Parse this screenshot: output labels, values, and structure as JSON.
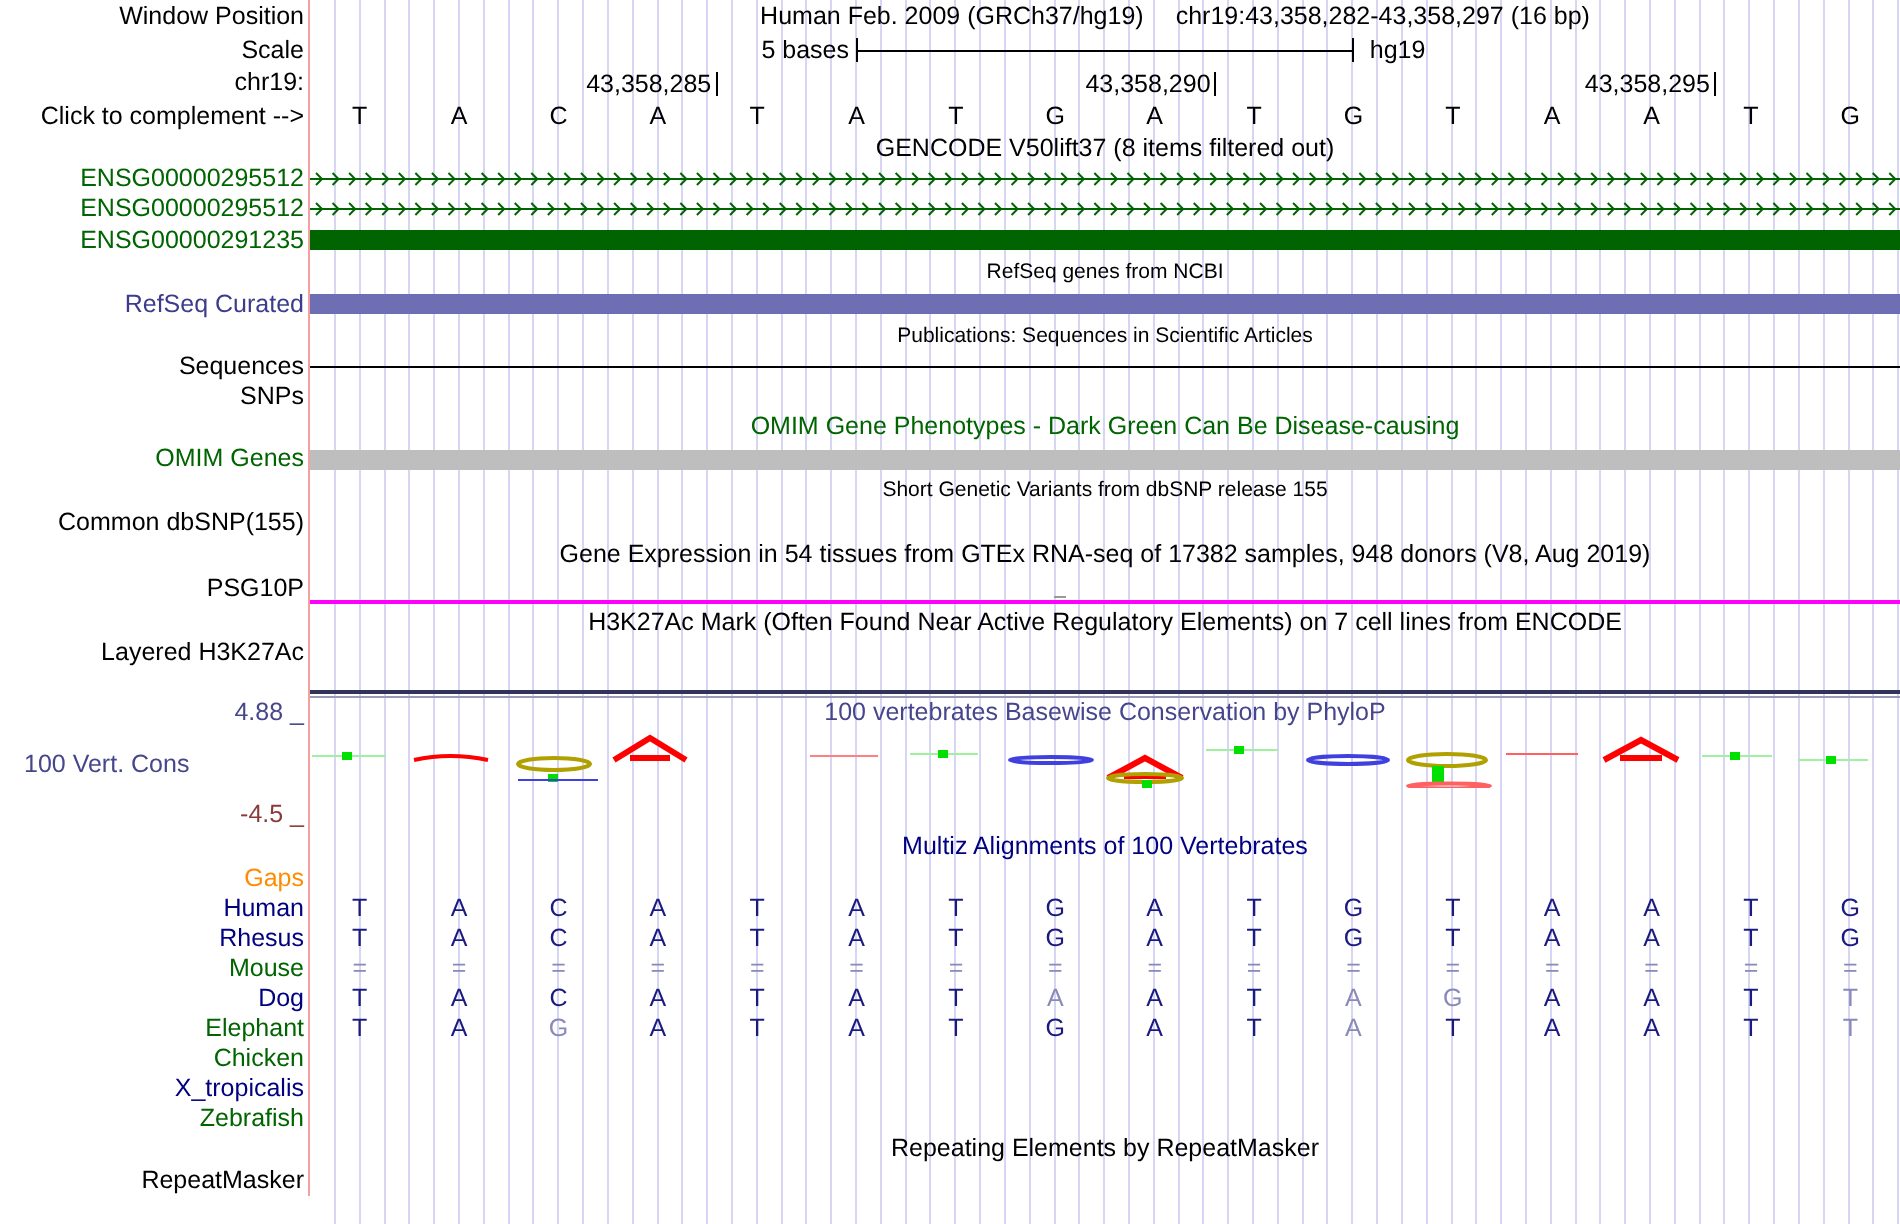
{
  "header": {
    "position_label": "Window Position",
    "assembly_title": "Human Feb. 2009 (GRCh37/hg19)",
    "position": "chr19:43,358,282-43,358,297 (16 bp)",
    "scale_label": "Scale",
    "scale_text": "5 bases",
    "scale_db": "hg19",
    "chrom_label": "chr19:",
    "ticks": [
      "43,358,285",
      "43,358,290",
      "43,358,295"
    ],
    "complement_label": "Click to complement -->",
    "bases": [
      "T",
      "A",
      "C",
      "A",
      "T",
      "A",
      "T",
      "G",
      "A",
      "T",
      "G",
      "T",
      "A",
      "A",
      "T",
      "G"
    ]
  },
  "tracks": [
    {
      "kind": "title",
      "text": "GENCODE V50lift37 (8 items filtered out)",
      "color": "#000000"
    },
    {
      "kind": "arrows",
      "label": "ENSG00000295512",
      "color": "#006400",
      "feature": {
        "color": "#006400"
      }
    },
    {
      "kind": "arrows",
      "label": "ENSG00000295512",
      "color": "#006400",
      "feature": {
        "color": "#006400"
      }
    },
    {
      "kind": "bar",
      "label": "ENSG00000291235",
      "color": "#006400",
      "feature": {
        "color": "#006400"
      }
    },
    {
      "kind": "subtitle",
      "text": "RefSeq genes from NCBI",
      "color": "#000000"
    },
    {
      "kind": "bar",
      "label": "RefSeq Curated",
      "color": "#3c3c8c",
      "feature": {
        "color": "#6e6eb4"
      }
    },
    {
      "kind": "subtitle",
      "text": "Publications: Sequences in Scientific Articles",
      "color": "#000000"
    },
    {
      "kind": "line",
      "label": "Sequences",
      "color": "#000000",
      "feature": {
        "color": "#000000"
      }
    },
    {
      "kind": "empty",
      "label": "SNPs",
      "color": "#000000"
    },
    {
      "kind": "title",
      "text": "OMIM Gene Phenotypes - Dark Green Can Be Disease-causing",
      "color": "#006400"
    },
    {
      "kind": "bar",
      "label": "OMIM Genes",
      "color": "#006400",
      "feature": {
        "color": "#bebebe"
      }
    },
    {
      "kind": "subtitle",
      "text": "Short Genetic Variants from dbSNP release 155",
      "color": "#000000"
    },
    {
      "kind": "empty",
      "label": "Common dbSNP(155)",
      "color": "#000000"
    },
    {
      "kind": "title",
      "text": "Gene Expression in 54 tissues from GTEx RNA-seq of 17382 samples, 948 donors (V8, Aug 2019)",
      "color": "#000000"
    },
    {
      "kind": "baseline",
      "label": "PSG10P",
      "color": "#000000",
      "feature": {
        "color": "#ff00ff"
      }
    },
    {
      "kind": "title",
      "text": "H3K27Ac Mark (Often Found Near Active Regulatory Elements) on 7 cell lines from ENCODE",
      "color": "#000000"
    },
    {
      "kind": "layered",
      "label": "Layered H3K27Ac",
      "color": "#000000",
      "feature": {
        "color": "#33335a"
      }
    },
    {
      "kind": "conservation",
      "label": "100 Vert. Cons",
      "color": "#46468c",
      "max": "4.88 _",
      "min": "-4.5 _",
      "text": "100 vertebrates Basewise Conservation by PhyloP"
    },
    {
      "kind": "title",
      "text": "Multiz Alignments of 100 Vertebrates",
      "color": "#000080"
    },
    {
      "kind": "empty",
      "label": "Gaps",
      "color": "#ff8c00"
    },
    {
      "kind": "alignment",
      "label": "Human",
      "color": "#000080",
      "bases": [
        {
          "text": "T",
          "faded": false
        },
        {
          "text": "A",
          "faded": false
        },
        {
          "text": "C",
          "faded": false
        },
        {
          "text": "A",
          "faded": false
        },
        {
          "text": "T",
          "faded": false
        },
        {
          "text": "A",
          "faded": false
        },
        {
          "text": "T",
          "faded": false
        },
        {
          "text": "G",
          "faded": false
        },
        {
          "text": "A",
          "faded": false
        },
        {
          "text": "T",
          "faded": false
        },
        {
          "text": "G",
          "faded": false
        },
        {
          "text": "T",
          "faded": false
        },
        {
          "text": "A",
          "faded": false
        },
        {
          "text": "A",
          "faded": false
        },
        {
          "text": "T",
          "faded": false
        },
        {
          "text": "G",
          "faded": false
        }
      ]
    },
    {
      "kind": "alignment",
      "label": "Rhesus",
      "color": "#000080",
      "bases": [
        {
          "text": "T",
          "faded": false
        },
        {
          "text": "A",
          "faded": false
        },
        {
          "text": "C",
          "faded": false
        },
        {
          "text": "A",
          "faded": false
        },
        {
          "text": "T",
          "faded": false
        },
        {
          "text": "A",
          "faded": false
        },
        {
          "text": "T",
          "faded": false
        },
        {
          "text": "G",
          "faded": false
        },
        {
          "text": "A",
          "faded": false
        },
        {
          "text": "T",
          "faded": false
        },
        {
          "text": "G",
          "faded": false
        },
        {
          "text": "T",
          "faded": false
        },
        {
          "text": "A",
          "faded": false
        },
        {
          "text": "A",
          "faded": false
        },
        {
          "text": "T",
          "faded": false
        },
        {
          "text": "G",
          "faded": false
        }
      ]
    },
    {
      "kind": "alignment",
      "label": "Mouse",
      "color": "#006400",
      "bases": [
        {
          "text": "=",
          "faded": true
        },
        {
          "text": "=",
          "faded": true
        },
        {
          "text": "=",
          "faded": true
        },
        {
          "text": "=",
          "faded": true
        },
        {
          "text": "=",
          "faded": true
        },
        {
          "text": "=",
          "faded": true
        },
        {
          "text": "=",
          "faded": true
        },
        {
          "text": "=",
          "faded": true
        },
        {
          "text": "=",
          "faded": true
        },
        {
          "text": "=",
          "faded": true
        },
        {
          "text": "=",
          "faded": true
        },
        {
          "text": "=",
          "faded": true
        },
        {
          "text": "=",
          "faded": true
        },
        {
          "text": "=",
          "faded": true
        },
        {
          "text": "=",
          "faded": true
        },
        {
          "text": "=",
          "faded": true
        }
      ]
    },
    {
      "kind": "alignment",
      "label": "Dog",
      "color": "#000080",
      "bases": [
        {
          "text": "T",
          "faded": false
        },
        {
          "text": "A",
          "faded": false
        },
        {
          "text": "C",
          "faded": false
        },
        {
          "text": "A",
          "faded": false
        },
        {
          "text": "T",
          "faded": false
        },
        {
          "text": "A",
          "faded": false
        },
        {
          "text": "T",
          "faded": false
        },
        {
          "text": "A",
          "faded": true
        },
        {
          "text": "A",
          "faded": false
        },
        {
          "text": "T",
          "faded": false
        },
        {
          "text": "A",
          "faded": true
        },
        {
          "text": "G",
          "faded": true
        },
        {
          "text": "A",
          "faded": false
        },
        {
          "text": "A",
          "faded": false
        },
        {
          "text": "T",
          "faded": false
        },
        {
          "text": "T",
          "faded": true
        }
      ]
    },
    {
      "kind": "alignment",
      "label": "Elephant",
      "color": "#006400",
      "bases": [
        {
          "text": "T",
          "faded": false
        },
        {
          "text": "A",
          "faded": false
        },
        {
          "text": "G",
          "faded": true
        },
        {
          "text": "A",
          "faded": false
        },
        {
          "text": "T",
          "faded": false
        },
        {
          "text": "A",
          "faded": false
        },
        {
          "text": "T",
          "faded": false
        },
        {
          "text": "G",
          "faded": false
        },
        {
          "text": "A",
          "faded": false
        },
        {
          "text": "T",
          "faded": false
        },
        {
          "text": "A",
          "faded": true
        },
        {
          "text": "T",
          "faded": false
        },
        {
          "text": "A",
          "faded": false
        },
        {
          "text": "A",
          "faded": false
        },
        {
          "text": "T",
          "faded": false
        },
        {
          "text": "T",
          "faded": true
        }
      ]
    },
    {
      "kind": "alignment",
      "label": "Chicken",
      "color": "#006400"
    },
    {
      "kind": "alignment",
      "label": "X_tropicalis",
      "color": "#000080"
    },
    {
      "kind": "alignment",
      "label": "Zebrafish",
      "color": "#006400"
    },
    {
      "kind": "title",
      "text": "Repeating Elements by RepeatMasker",
      "color": "#000000"
    },
    {
      "kind": "empty",
      "label": "RepeatMasker",
      "color": "#000000"
    }
  ]
}
